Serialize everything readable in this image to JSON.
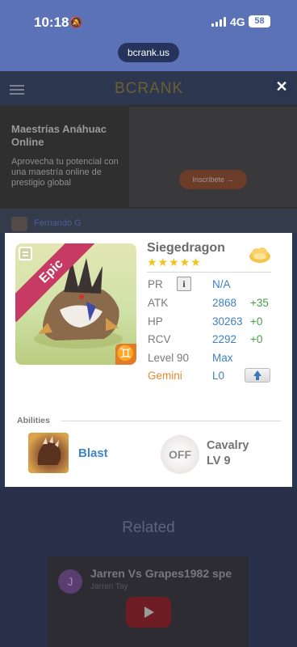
{
  "status_bar": {
    "time": "10:18",
    "network": "4G",
    "battery": "58",
    "url": "bcrank.us"
  },
  "site": {
    "logo": "BCRANK",
    "close_symbol": "✕",
    "ad": {
      "title": "Maestrías Anáhuac Online",
      "body": "Aprovecha tu potencial con una maestría online de prestigio global",
      "cta": "Inscríbete →"
    },
    "author": "Fernando G",
    "related_heading": "Related",
    "video": {
      "avatar_letter": "J",
      "title": "Jarren Vs Grapes1982 spe",
      "channel": "Jarren Tay"
    }
  },
  "monster": {
    "rarity": "Epic",
    "name": "Siegedragon",
    "stars": "★★★★★",
    "attribute_symbol": "♊",
    "stats": [
      {
        "label": "PR",
        "value": "N/A",
        "bonus": ""
      },
      {
        "label": "ATK",
        "value": "2868",
        "bonus": "+35"
      },
      {
        "label": "HP",
        "value": "30263",
        "bonus": "+0"
      },
      {
        "label": "RCV",
        "value": "2292",
        "bonus": "+0"
      },
      {
        "label": "Level 90",
        "value": "Max",
        "bonus": ""
      },
      {
        "label": "Gemini",
        "value": "L0",
        "bonus": ""
      }
    ],
    "info_symbol": "i",
    "abilities_heading": "Abilities",
    "skill": {
      "name": "Blast"
    },
    "leader": {
      "badge": "OFF",
      "name": "Cavalry",
      "level": "LV 9"
    }
  },
  "colors": {
    "page_bg": "#2a3552",
    "status_bg": "#5b73b6",
    "epic_ribbon": "#c63a63",
    "value_blue": "#3f7fc2",
    "bonus_green": "#43a045",
    "gemini_orange": "#e08b2e",
    "stars_gold": "#f2c11a"
  }
}
